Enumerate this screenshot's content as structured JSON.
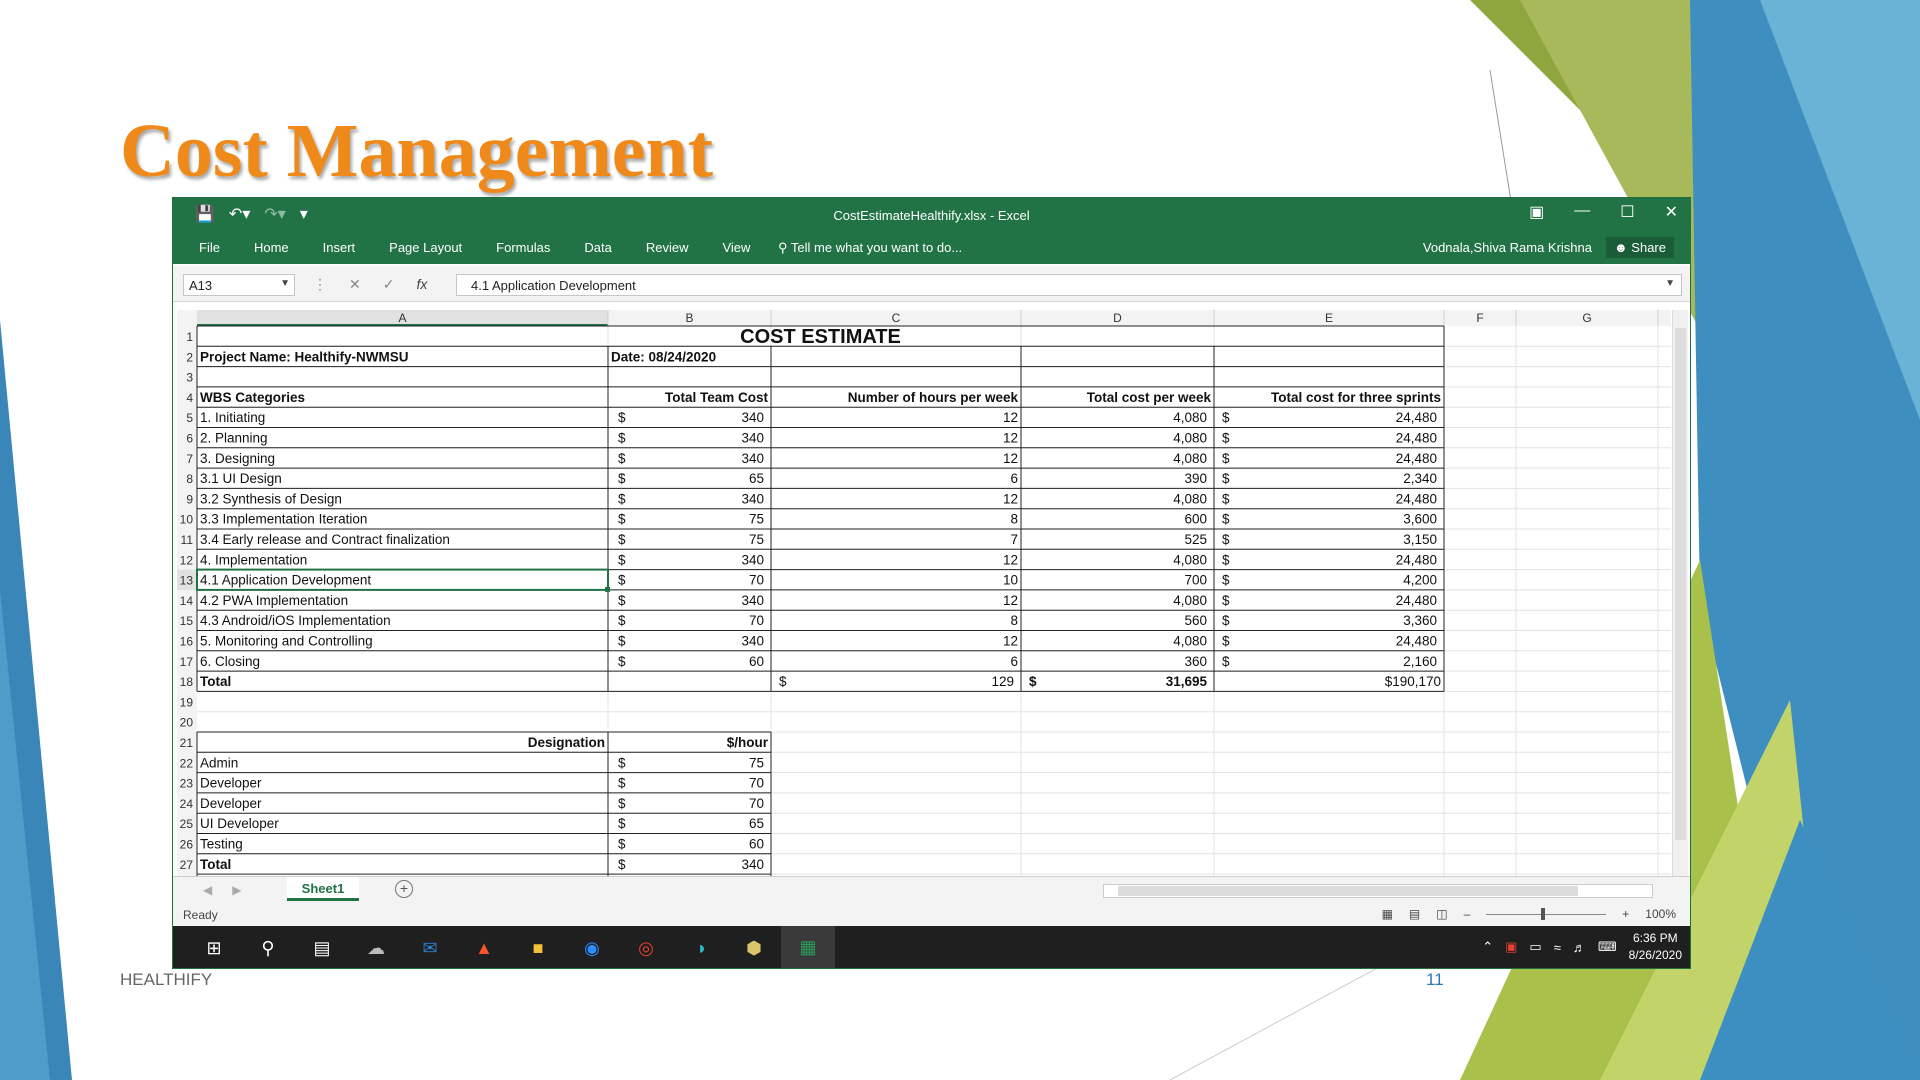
{
  "slide": {
    "title": "Cost Management",
    "footer": "HEALTHIFY",
    "page_number": "11"
  },
  "excel": {
    "window_title": "CostEstimateHealthify.xlsx - Excel",
    "ribbon_tabs": [
      "File",
      "Home",
      "Insert",
      "Page Layout",
      "Formulas",
      "Data",
      "Review",
      "View"
    ],
    "tell_me": "Tell me what you want to do...",
    "user": "Vodnala,Shiva Rama Krishna",
    "share": "Share",
    "name_box": "A13",
    "formula": "4.1 Application Development",
    "columns": [
      "A",
      "B",
      "C",
      "D",
      "E",
      "F",
      "G"
    ],
    "sheet_tab": "Sheet1",
    "status": "Ready",
    "zoom": "100%",
    "selected_row": 13,
    "report_title": "COST ESTIMATE",
    "project_name": "Project Name: Healthify-NWMSU",
    "date": "Date: 08/24/2020",
    "headers": [
      "WBS Categories",
      "Total Team Cost",
      "Number of hours per week",
      "Total cost per week",
      "Total cost for three sprints"
    ],
    "rows": [
      {
        "cat": "1. Initiating",
        "team_cost": "340",
        "hours": "12",
        "per_week": "4,080",
        "sprints": "24,480"
      },
      {
        "cat": "2. Planning",
        "team_cost": "340",
        "hours": "12",
        "per_week": "4,080",
        "sprints": "24,480"
      },
      {
        "cat": "3. Designing",
        "team_cost": "340",
        "hours": "12",
        "per_week": "4,080",
        "sprints": "24,480"
      },
      {
        "cat": "  3.1 UI Design",
        "team_cost": "65",
        "hours": "6",
        "per_week": "390",
        "sprints": "2,340"
      },
      {
        "cat": "  3.2 Synthesis of Design",
        "team_cost": "340",
        "hours": "12",
        "per_week": "4,080",
        "sprints": "24,480"
      },
      {
        "cat": "  3.3 Implementation Iteration",
        "team_cost": "75",
        "hours": "8",
        "per_week": "600",
        "sprints": "3,600"
      },
      {
        "cat": "  3.4 Early release and Contract finalization",
        "team_cost": "75",
        "hours": "7",
        "per_week": "525",
        "sprints": "3,150"
      },
      {
        "cat": "4. Implementation",
        "team_cost": "340",
        "hours": "12",
        "per_week": "4,080",
        "sprints": "24,480"
      },
      {
        "cat": "  4.1 Application Development",
        "team_cost": "70",
        "hours": "10",
        "per_week": "700",
        "sprints": "4,200"
      },
      {
        "cat": "  4.2 PWA Implementation",
        "team_cost": "340",
        "hours": "12",
        "per_week": "4,080",
        "sprints": "24,480"
      },
      {
        "cat": "  4.3 Android/iOS Implementation",
        "team_cost": "70",
        "hours": "8",
        "per_week": "560",
        "sprints": "3,360"
      },
      {
        "cat": "5. Monitoring and Controlling",
        "team_cost": "340",
        "hours": "12",
        "per_week": "4,080",
        "sprints": "24,480"
      },
      {
        "cat": "6. Closing",
        "team_cost": "60",
        "hours": "6",
        "per_week": "360",
        "sprints": "2,160"
      }
    ],
    "total_row": {
      "label": "Total",
      "hours": "129",
      "per_week": "31,695",
      "sprints": "$190,170"
    },
    "designation_header": "Designation",
    "rate_header": "$/hour",
    "designations": [
      {
        "name": " Admin",
        "rate": "75"
      },
      {
        "name": "  Developer",
        "rate": "70"
      },
      {
        "name": " Developer",
        "rate": "70"
      },
      {
        "name": " UI Developer",
        "rate": "65"
      },
      {
        "name": " Testing",
        "rate": "60"
      }
    ],
    "designation_total": {
      "label": "Total",
      "rate": "340"
    },
    "currency_symbol": "$"
  },
  "taskbar": {
    "time": "6:36 PM",
    "date": "8/26/2020",
    "apps": [
      "start-icon",
      "search-icon",
      "task-view-icon",
      "onedrive-icon",
      "outlook-icon",
      "brave-icon",
      "file-explorer-icon",
      "zoom-icon",
      "chrome-icon",
      "edge-icon",
      "app-cube-icon",
      "excel-icon"
    ]
  },
  "colors": {
    "excel_green": "#217346",
    "title_orange": "#ef8a1a"
  }
}
